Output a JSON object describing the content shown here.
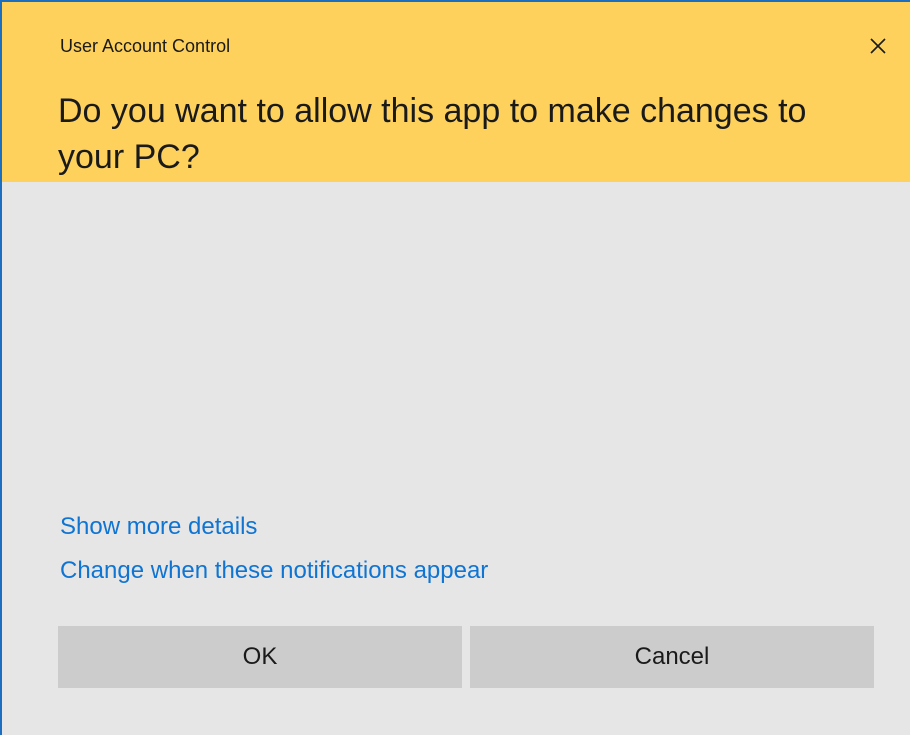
{
  "window": {
    "title": "User Account Control",
    "close_icon": "close-icon"
  },
  "prompt": {
    "question": "Do you want to allow this app to make changes to your PC?"
  },
  "links": {
    "show_details": "Show more details",
    "change_notifications": "Change when these notifications appear"
  },
  "buttons": {
    "ok_label": "OK",
    "cancel_label": "Cancel"
  },
  "colors": {
    "header_background": "#fdd15c",
    "body_background": "#e6e6e6",
    "link": "#0f74d2",
    "button_background": "#cccccc",
    "window_border": "#1e6ec0"
  }
}
